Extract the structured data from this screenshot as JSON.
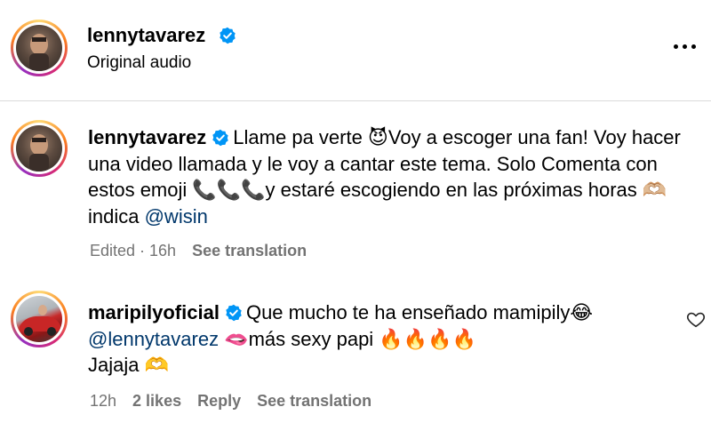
{
  "post_header": {
    "username": "lennytavarez",
    "subtitle": "Original audio"
  },
  "caption": {
    "username": "lennytavarez",
    "text_part1": "Llame pa verte 😈Voy a escoger una fan! Voy hacer una video llamada y le voy a cantar este tema. Solo Comenta con estos emoji 📞📞📞y estaré escogiendo en las próximas horas 🫶🏼 indica ",
    "mention": "@wisin",
    "meta": {
      "edited": "Edited · 16h",
      "translation": "See translation"
    }
  },
  "comment": {
    "username": "maripilyoficial",
    "text_part1": "Que mucho te ha enseñado mamipily😂",
    "mention": "@lennytavarez",
    "text_part2": " 🫦más sexy papi 🔥🔥🔥🔥",
    "text_line3": "Jajaja 🫶",
    "meta": {
      "time": "12h",
      "likes": "2 likes",
      "reply": "Reply",
      "translation": "See translation"
    }
  },
  "colors": {
    "verified": "#0095f6",
    "mention": "#00376b",
    "meta": "#737373",
    "divider": "#dbdbdb"
  },
  "icons": [
    "verified-badge-icon",
    "more-options-icon",
    "heart-icon"
  ]
}
